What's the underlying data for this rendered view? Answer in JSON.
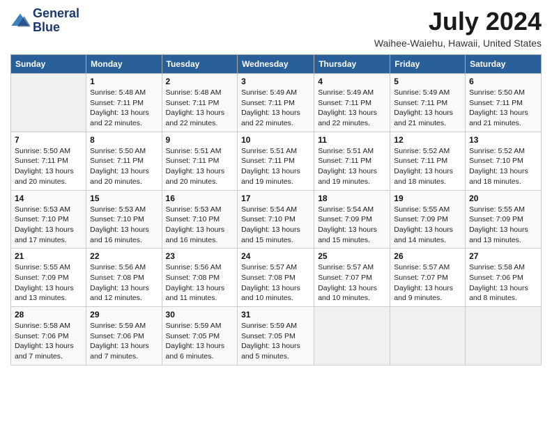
{
  "logo": {
    "line1": "General",
    "line2": "Blue"
  },
  "title": "July 2024",
  "location": "Waihee-Waiehu, Hawaii, United States",
  "days_header": [
    "Sunday",
    "Monday",
    "Tuesday",
    "Wednesday",
    "Thursday",
    "Friday",
    "Saturday"
  ],
  "weeks": [
    [
      {
        "day": "",
        "info": ""
      },
      {
        "day": "1",
        "info": "Sunrise: 5:48 AM\nSunset: 7:11 PM\nDaylight: 13 hours\nand 22 minutes."
      },
      {
        "day": "2",
        "info": "Sunrise: 5:48 AM\nSunset: 7:11 PM\nDaylight: 13 hours\nand 22 minutes."
      },
      {
        "day": "3",
        "info": "Sunrise: 5:49 AM\nSunset: 7:11 PM\nDaylight: 13 hours\nand 22 minutes."
      },
      {
        "day": "4",
        "info": "Sunrise: 5:49 AM\nSunset: 7:11 PM\nDaylight: 13 hours\nand 22 minutes."
      },
      {
        "day": "5",
        "info": "Sunrise: 5:49 AM\nSunset: 7:11 PM\nDaylight: 13 hours\nand 21 minutes."
      },
      {
        "day": "6",
        "info": "Sunrise: 5:50 AM\nSunset: 7:11 PM\nDaylight: 13 hours\nand 21 minutes."
      }
    ],
    [
      {
        "day": "7",
        "info": "Sunrise: 5:50 AM\nSunset: 7:11 PM\nDaylight: 13 hours\nand 20 minutes."
      },
      {
        "day": "8",
        "info": "Sunrise: 5:50 AM\nSunset: 7:11 PM\nDaylight: 13 hours\nand 20 minutes."
      },
      {
        "day": "9",
        "info": "Sunrise: 5:51 AM\nSunset: 7:11 PM\nDaylight: 13 hours\nand 20 minutes."
      },
      {
        "day": "10",
        "info": "Sunrise: 5:51 AM\nSunset: 7:11 PM\nDaylight: 13 hours\nand 19 minutes."
      },
      {
        "day": "11",
        "info": "Sunrise: 5:51 AM\nSunset: 7:11 PM\nDaylight: 13 hours\nand 19 minutes."
      },
      {
        "day": "12",
        "info": "Sunrise: 5:52 AM\nSunset: 7:11 PM\nDaylight: 13 hours\nand 18 minutes."
      },
      {
        "day": "13",
        "info": "Sunrise: 5:52 AM\nSunset: 7:10 PM\nDaylight: 13 hours\nand 18 minutes."
      }
    ],
    [
      {
        "day": "14",
        "info": "Sunrise: 5:53 AM\nSunset: 7:10 PM\nDaylight: 13 hours\nand 17 minutes."
      },
      {
        "day": "15",
        "info": "Sunrise: 5:53 AM\nSunset: 7:10 PM\nDaylight: 13 hours\nand 16 minutes."
      },
      {
        "day": "16",
        "info": "Sunrise: 5:53 AM\nSunset: 7:10 PM\nDaylight: 13 hours\nand 16 minutes."
      },
      {
        "day": "17",
        "info": "Sunrise: 5:54 AM\nSunset: 7:10 PM\nDaylight: 13 hours\nand 15 minutes."
      },
      {
        "day": "18",
        "info": "Sunrise: 5:54 AM\nSunset: 7:09 PM\nDaylight: 13 hours\nand 15 minutes."
      },
      {
        "day": "19",
        "info": "Sunrise: 5:55 AM\nSunset: 7:09 PM\nDaylight: 13 hours\nand 14 minutes."
      },
      {
        "day": "20",
        "info": "Sunrise: 5:55 AM\nSunset: 7:09 PM\nDaylight: 13 hours\nand 13 minutes."
      }
    ],
    [
      {
        "day": "21",
        "info": "Sunrise: 5:55 AM\nSunset: 7:09 PM\nDaylight: 13 hours\nand 13 minutes."
      },
      {
        "day": "22",
        "info": "Sunrise: 5:56 AM\nSunset: 7:08 PM\nDaylight: 13 hours\nand 12 minutes."
      },
      {
        "day": "23",
        "info": "Sunrise: 5:56 AM\nSunset: 7:08 PM\nDaylight: 13 hours\nand 11 minutes."
      },
      {
        "day": "24",
        "info": "Sunrise: 5:57 AM\nSunset: 7:08 PM\nDaylight: 13 hours\nand 10 minutes."
      },
      {
        "day": "25",
        "info": "Sunrise: 5:57 AM\nSunset: 7:07 PM\nDaylight: 13 hours\nand 10 minutes."
      },
      {
        "day": "26",
        "info": "Sunrise: 5:57 AM\nSunset: 7:07 PM\nDaylight: 13 hours\nand 9 minutes."
      },
      {
        "day": "27",
        "info": "Sunrise: 5:58 AM\nSunset: 7:06 PM\nDaylight: 13 hours\nand 8 minutes."
      }
    ],
    [
      {
        "day": "28",
        "info": "Sunrise: 5:58 AM\nSunset: 7:06 PM\nDaylight: 13 hours\nand 7 minutes."
      },
      {
        "day": "29",
        "info": "Sunrise: 5:59 AM\nSunset: 7:06 PM\nDaylight: 13 hours\nand 7 minutes."
      },
      {
        "day": "30",
        "info": "Sunrise: 5:59 AM\nSunset: 7:05 PM\nDaylight: 13 hours\nand 6 minutes."
      },
      {
        "day": "31",
        "info": "Sunrise: 5:59 AM\nSunset: 7:05 PM\nDaylight: 13 hours\nand 5 minutes."
      },
      {
        "day": "",
        "info": ""
      },
      {
        "day": "",
        "info": ""
      },
      {
        "day": "",
        "info": ""
      }
    ]
  ]
}
